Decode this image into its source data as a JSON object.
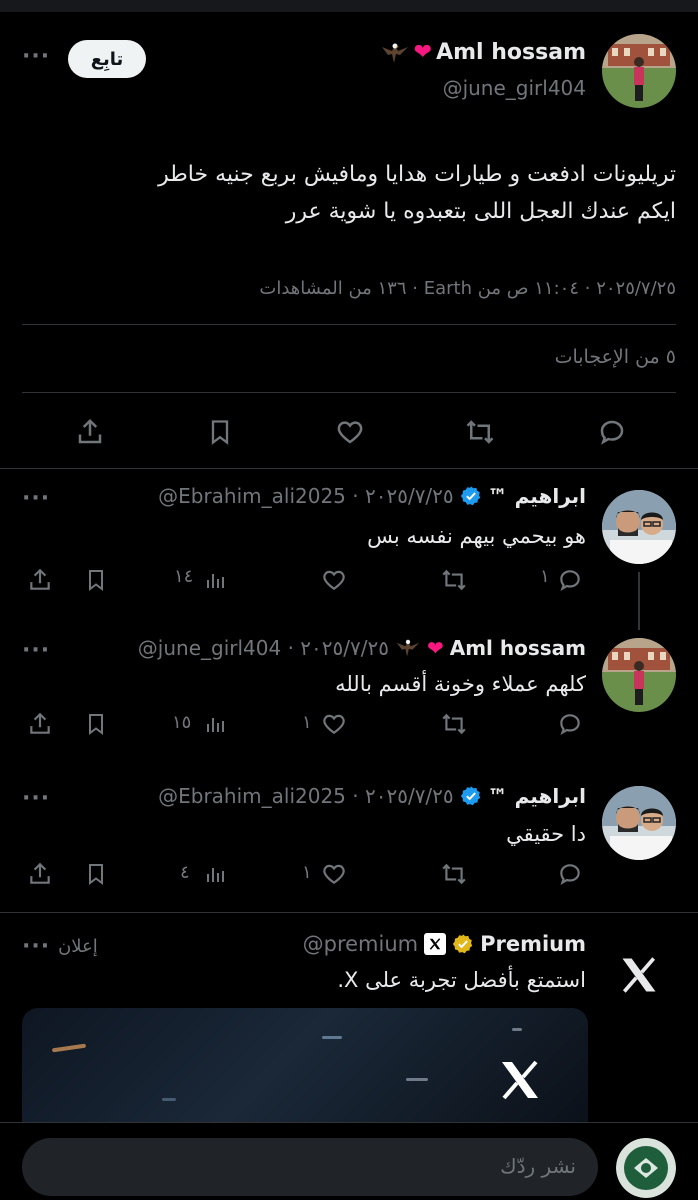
{
  "post": {
    "author_name": "Aml hossam",
    "author_handle": "@june_girl404",
    "follow_label": "تابِع",
    "text_line1": "تريليونات  ادفعت و طيارات هدايا  ومافيش بربع جنيه خاطر",
    "text_line2": "ايكم  عندك العجل اللى بتعبدوه يا شوية عرر",
    "meta": "٢٠٢٥/٧/٢٥ · ١١:٠٤ ص من Earth · ١٣٦ من المشاهدات",
    "likes_summary": "٥ من الإعجابات"
  },
  "replies": [
    {
      "name": "ابراهيم ™",
      "handle_date": "@Ebrahim_ali2025 · ٢٠٢٥/٧/٢٥",
      "text": "هو بيحمي بيهم نفسه بس",
      "reply_count": "١",
      "views": "١٤"
    },
    {
      "name": "Aml hossam",
      "handle_date": "@june_girl404 · ٢٠٢٥/٧/٢٥",
      "text": "كلهم عملاء وخونة أقسم بالله",
      "reply_count": "",
      "like_count": "١",
      "views": "١٥"
    },
    {
      "name": "ابراهيم ™",
      "handle_date": "@Ebrahim_ali2025 · ٢٠٢٥/٧/٢٥",
      "text": "دا حقيقي",
      "reply_count": "",
      "like_count": "١",
      "views": "٤"
    }
  ],
  "ad": {
    "name": "Premium",
    "handle": "@premium",
    "label": "إعلان",
    "text": "استمتع بأفضل تجربة على X."
  },
  "composer": {
    "placeholder": "نشر ردّك"
  },
  "colors": {
    "background": "#000000",
    "text": "#e7e9ea",
    "muted": "#71767b",
    "verified_blue": "#1d9bf0",
    "verified_gold": "#e2b719",
    "heart_red": "#f91880"
  },
  "icons": [
    "share-icon",
    "bookmark-icon",
    "like-icon",
    "repost-icon",
    "reply-icon",
    "views-icon",
    "more-icon",
    "x-logo-icon",
    "eagle-emoji",
    "heart-emoji",
    "verified-badge"
  ]
}
